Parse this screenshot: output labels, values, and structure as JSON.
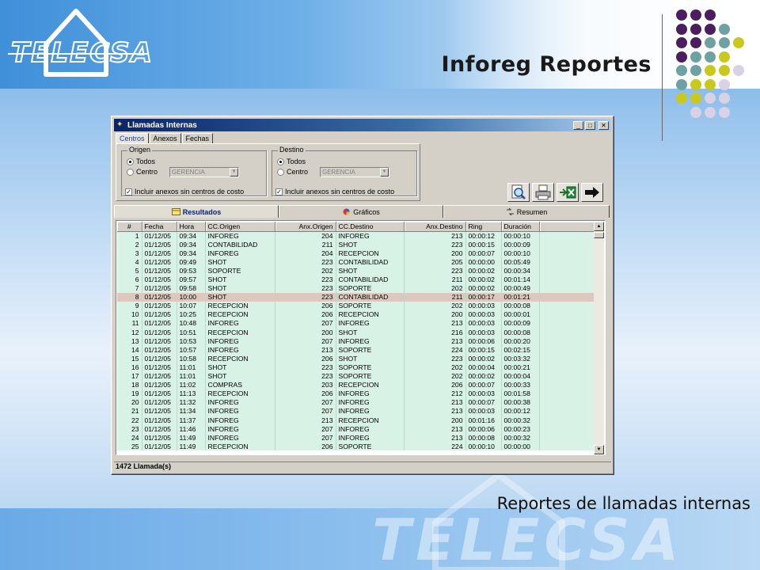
{
  "slide": {
    "title": "Inforeg Reportes",
    "subtitle": "Reportes de llamadas internas",
    "logo_text": "TELECSA",
    "watermark_text": "TELECSA",
    "dot_colors": [
      "#4b1f5e",
      "#6fa1a3",
      "#c9c81e",
      "#d8d2e4"
    ]
  },
  "window": {
    "title": "Llamadas Internas",
    "minimize_glyph": "_",
    "maximize_glyph": "□",
    "close_glyph": "✕",
    "tabs": [
      "Centros",
      "Anexos",
      "Fechas"
    ],
    "origin": {
      "legend": "Origen",
      "opt_all": "Todos",
      "opt_center": "Centro",
      "combo_value": "GERENCIA",
      "include_label": "Incluir anexos sin centros de costo"
    },
    "destination": {
      "legend": "Destino",
      "opt_all": "Todos",
      "opt_center": "Centro",
      "combo_value": "GERENCIA",
      "include_label": "Incluir anexos sin centros de costo"
    },
    "toolbar": [
      "magnifier-icon",
      "printer-icon",
      "excel-export-icon",
      "arrow-right-icon"
    ],
    "result_tabs": [
      "Resultados",
      "Gráficos",
      "Resumen"
    ],
    "columns": [
      "#",
      "Fecha",
      "Hora",
      "CC.Origen",
      "Anx.Origen",
      "CC.Destino",
      "Anx.Destino",
      "Ring",
      "Duración"
    ],
    "selected_row": 8,
    "rows": [
      [
        "1",
        "01/12/05",
        "09:34",
        "INFOREG",
        "204",
        "INFOREG",
        "213",
        "00:00:12",
        "00:00:10"
      ],
      [
        "2",
        "01/12/05",
        "09:34",
        "CONTABILIDAD",
        "211",
        "SHOT",
        "223",
        "00:00:15",
        "00:00:09"
      ],
      [
        "3",
        "01/12/05",
        "09:34",
        "INFOREG",
        "204",
        "RECEPCION",
        "200",
        "00:00:07",
        "00:00:10"
      ],
      [
        "4",
        "01/12/05",
        "09:49",
        "SHOT",
        "223",
        "CONTABILIDAD",
        "205",
        "00:00:00",
        "00:05:49"
      ],
      [
        "5",
        "01/12/05",
        "09:53",
        "SOPORTE",
        "202",
        "SHOT",
        "223",
        "00:00:02",
        "00:00:34"
      ],
      [
        "6",
        "01/12/05",
        "09:57",
        "SHOT",
        "223",
        "CONTABILIDAD",
        "211",
        "00:00:02",
        "00:01:14"
      ],
      [
        "7",
        "01/12/05",
        "09:58",
        "SHOT",
        "223",
        "SOPORTE",
        "202",
        "00:00:02",
        "00:00:49"
      ],
      [
        "8",
        "01/12/05",
        "10:00",
        "SHOT",
        "223",
        "CONTABILIDAD",
        "211",
        "00:00:17",
        "00:01:21"
      ],
      [
        "9",
        "01/12/05",
        "10:07",
        "RECEPCION",
        "206",
        "SOPORTE",
        "202",
        "00:00:03",
        "00:00:08"
      ],
      [
        "10",
        "01/12/05",
        "10:25",
        "RECEPCION",
        "206",
        "RECEPCION",
        "200",
        "00:00:03",
        "00:00:01"
      ],
      [
        "11",
        "01/12/05",
        "10:48",
        "INFOREG",
        "207",
        "INFOREG",
        "213",
        "00:00:03",
        "00:00:09"
      ],
      [
        "12",
        "01/12/05",
        "10:51",
        "RECEPCION",
        "200",
        "SHOT",
        "216",
        "00:00:03",
        "00:00:08"
      ],
      [
        "13",
        "01/12/05",
        "10:53",
        "INFOREG",
        "207",
        "INFOREG",
        "213",
        "00:00:06",
        "00:00:20"
      ],
      [
        "14",
        "01/12/05",
        "10:57",
        "INFOREG",
        "213",
        "SOPORTE",
        "224",
        "00:00:15",
        "00:02:15"
      ],
      [
        "15",
        "01/12/05",
        "10:58",
        "RECEPCION",
        "206",
        "SHOT",
        "223",
        "00:00:02",
        "00:03:32"
      ],
      [
        "16",
        "01/12/05",
        "11:01",
        "SHOT",
        "223",
        "SOPORTE",
        "202",
        "00:00:04",
        "00:00:21"
      ],
      [
        "17",
        "01/12/05",
        "11:01",
        "SHOT",
        "223",
        "SOPORTE",
        "202",
        "00:00:02",
        "00:00:04"
      ],
      [
        "18",
        "01/12/05",
        "11:02",
        "COMPRAS",
        "203",
        "RECEPCION",
        "206",
        "00:00:07",
        "00:00:33"
      ],
      [
        "19",
        "01/12/05",
        "11:13",
        "RECEPCION",
        "206",
        "INFOREG",
        "212",
        "00:00:03",
        "00:01:58"
      ],
      [
        "20",
        "01/12/05",
        "11:32",
        "INFOREG",
        "207",
        "INFOREG",
        "213",
        "00:00:07",
        "00:00:38"
      ],
      [
        "21",
        "01/12/05",
        "11:34",
        "INFOREG",
        "207",
        "INFOREG",
        "213",
        "00:00:03",
        "00:00:12"
      ],
      [
        "22",
        "01/12/05",
        "11:37",
        "INFOREG",
        "213",
        "RECEPCION",
        "200",
        "00:01:16",
        "00:00:32"
      ],
      [
        "23",
        "01/12/05",
        "11:46",
        "INFOREG",
        "207",
        "INFOREG",
        "213",
        "00:00:06",
        "00:00:23"
      ],
      [
        "24",
        "01/12/05",
        "11:49",
        "INFOREG",
        "207",
        "INFOREG",
        "213",
        "00:00:08",
        "00:00:32"
      ],
      [
        "25",
        "01/12/05",
        "11:49",
        "RECEPCION",
        "206",
        "SOPORTE",
        "224",
        "00:00:10",
        "00:00:00"
      ]
    ],
    "status": "1472 Llamada(s)"
  }
}
